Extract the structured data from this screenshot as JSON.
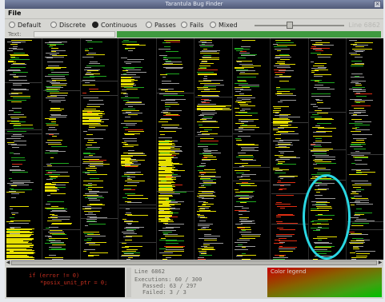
{
  "window": {
    "title": "Tarantula Bug Finder",
    "close_glyph": "×"
  },
  "menu": {
    "file": "File"
  },
  "toolbar": {
    "modes": [
      {
        "label": "Default",
        "selected": false
      },
      {
        "label": "Discrete",
        "selected": false
      },
      {
        "label": "Continuous",
        "selected": true
      },
      {
        "label": "Passes",
        "selected": false
      },
      {
        "label": "Fails",
        "selected": false
      },
      {
        "label": "Mixed",
        "selected": false
      }
    ],
    "slider_value_fraction": 0.38,
    "line_label": "Line 6862"
  },
  "text_row": {
    "label": "Text:"
  },
  "code_view": {
    "line1": "if (error != 0)",
    "line2": "*posix_unit_ptr = 0;"
  },
  "stats": {
    "line": "Line 6862",
    "executions": "Executions: 60 / 300",
    "passed": "Passed: 63 / 297",
    "failed": "Failed: 3 / 3"
  },
  "legend": {
    "title": "Color legend"
  },
  "colors": {
    "pass": "#1faa1f",
    "fail": "#e02d12",
    "mixed": "#e6df00",
    "neutral": "#9a9a9a",
    "annotation": "#29d7e3"
  },
  "icons": {
    "scroll_left": "◀",
    "scroll_right": "▶"
  }
}
